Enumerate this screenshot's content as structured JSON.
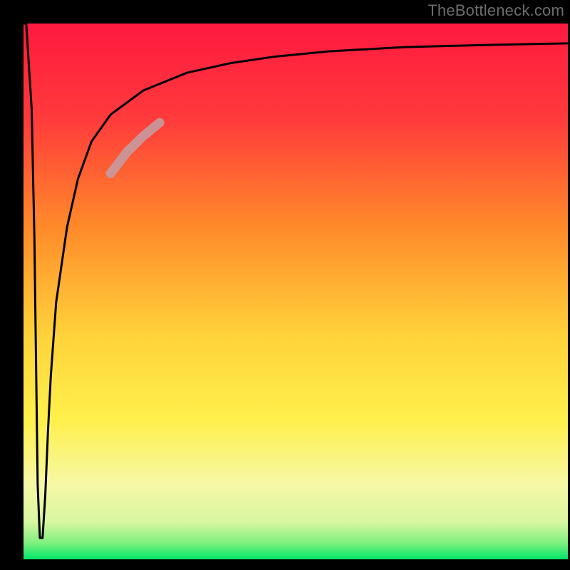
{
  "watermark": "TheBottleneck.com",
  "chart_data": {
    "type": "line",
    "title": "",
    "xlabel": "",
    "ylabel": "",
    "xlim": [
      0,
      100
    ],
    "ylim": [
      0,
      100
    ],
    "grid": false,
    "legend": false,
    "annotations": [],
    "background_gradient": {
      "top_color": "#ff1940",
      "mid_colors": [
        "#ff7a2a",
        "#ffe13d",
        "#f7f9a8"
      ],
      "bottom_color": "#00e66a"
    },
    "series": [
      {
        "name": "curve",
        "stroke": "#000000",
        "stroke_width": 3,
        "x": [
          0,
          0.5,
          1.5,
          2.0,
          2.6,
          3.0,
          3.5,
          4.0,
          4.5,
          5.0,
          6.0,
          8.0,
          10.0,
          12.5,
          16.0,
          22.0,
          30.0,
          38.0,
          46.0,
          56.0,
          70.0,
          85.0,
          100.0
        ],
        "y": [
          100,
          100,
          84,
          60,
          14,
          4,
          4,
          12,
          24,
          34,
          48,
          62,
          71,
          78,
          83,
          87.5,
          90.8,
          92.6,
          93.8,
          94.8,
          95.6,
          96.0,
          96.3
        ]
      },
      {
        "name": "highlight-segment",
        "stroke": "#c69aa0",
        "stroke_width": 13,
        "opacity": 0.9,
        "x": [
          16.0,
          19.0,
          22.0,
          25.0
        ],
        "y": [
          72.0,
          76.0,
          79.0,
          81.5
        ]
      }
    ]
  }
}
